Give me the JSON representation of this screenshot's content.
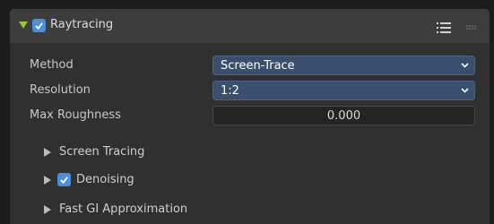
{
  "panel": {
    "title": "Raytracing",
    "enabled": true,
    "icons": {
      "expand": "triangle-down-icon",
      "list": "list-icon",
      "grip": "drag-grip-icon"
    }
  },
  "rows": {
    "method": {
      "label": "Method",
      "value": "Screen-Trace"
    },
    "resolution": {
      "label": "Resolution",
      "value": "1:2"
    },
    "max_roughness": {
      "label": "Max Roughness",
      "value": "0.000"
    }
  },
  "subpanels": {
    "screen_tracing": {
      "label": "Screen Tracing"
    },
    "denoising": {
      "label": "Denoising",
      "enabled": true
    },
    "fast_gi": {
      "label": "Fast GI Approximation"
    }
  },
  "colors": {
    "accent": "#4b8fdc",
    "select_bg": "#3a4f6e",
    "expand_arrow": "#8fc93a"
  }
}
